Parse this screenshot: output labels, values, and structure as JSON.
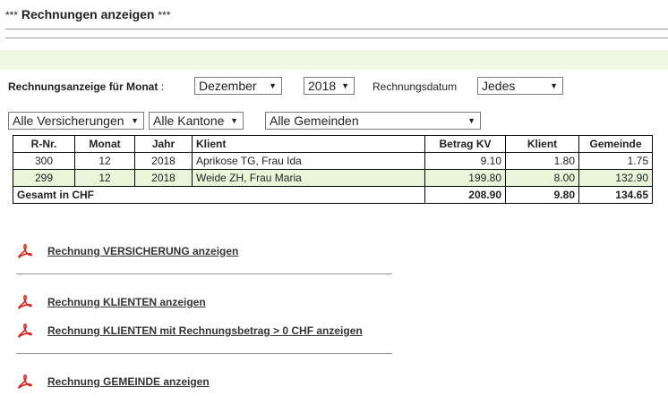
{
  "page": {
    "title": "Rechnungen anzeigen",
    "title_stars": "***"
  },
  "filters": {
    "month_label": "Rechnungsanzeige für Monat",
    "month_sep": ":",
    "month_value": "Dezember",
    "year_value": "2018",
    "date_label": "Rechnungsdatum",
    "date_value": "Jedes",
    "insurance_value": "Alle Versicherungen",
    "canton_value": "Alle Kantone",
    "municipality_value": "Alle Gemeinden"
  },
  "table": {
    "headers": [
      "R-Nr.",
      "Monat",
      "Jahr",
      "Klient",
      "Betrag KV",
      "Klient",
      "Gemeinde"
    ],
    "rows": [
      [
        "300",
        "12",
        "2018",
        "Aprikose TG, Frau Ida",
        "9.10",
        "1.80",
        "1.75"
      ],
      [
        "299",
        "12",
        "2018",
        "Weide ZH, Frau Maria",
        "199.80",
        "8.00",
        "132.90"
      ]
    ],
    "total": {
      "label": "Gesamt in CHF",
      "betrag_kv": "208.90",
      "klient": "9.80",
      "gemeinde": "134.65"
    }
  },
  "links": {
    "versicherung": "Rechnung VERSICHERUNG anzeigen",
    "klienten": "Rechnung KLIENTEN anzeigen",
    "klienten_positive": "Rechnung KLIENTEN mit Rechnungsbetrag > 0 CHF anzeigen",
    "gemeinde": "Rechnung GEMEINDE anzeigen"
  },
  "colors": {
    "band": "#eef8e4",
    "row_alt": "#e8f5d8",
    "pdf_red": "#d9271d"
  },
  "icons": {
    "dropdown": "▼",
    "pdf": "pdf-icon"
  }
}
